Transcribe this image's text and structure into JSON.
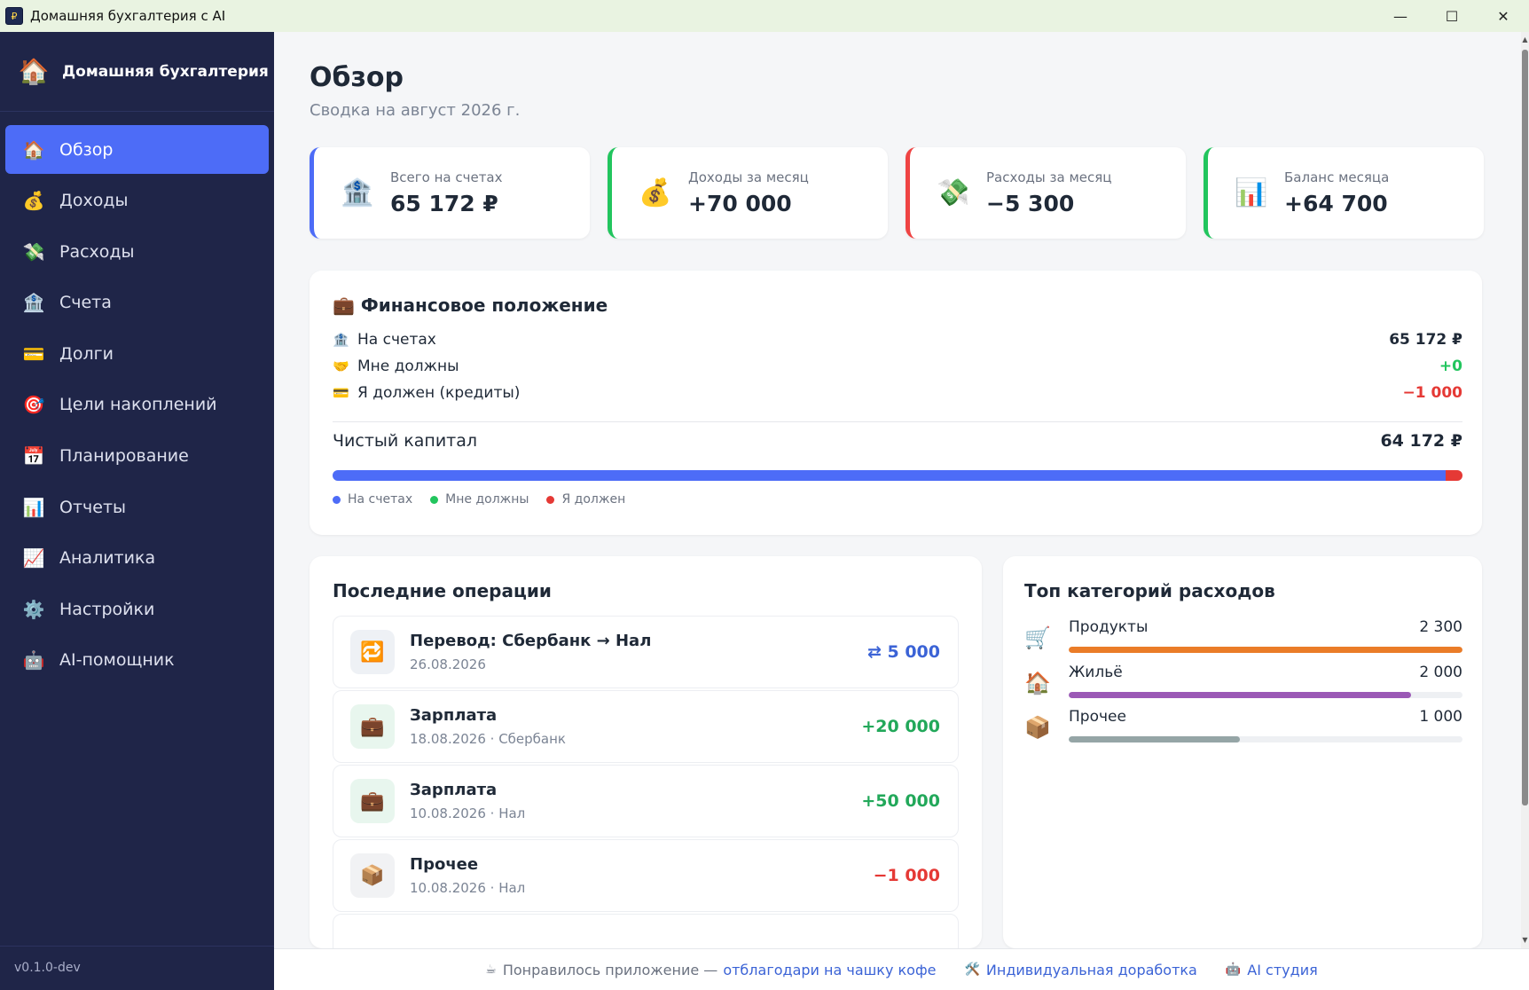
{
  "window": {
    "title": "Домашняя бухгалтерия с AI",
    "icon": "app-icon"
  },
  "sidebar": {
    "brand": {
      "icon": "house-icon",
      "name": "Домашняя бухгалтерия"
    },
    "items": [
      {
        "icon": "house-icon",
        "label": "Обзор",
        "active": true
      },
      {
        "icon": "money-bag-icon",
        "label": "Доходы"
      },
      {
        "icon": "money-wings-icon",
        "label": "Расходы"
      },
      {
        "icon": "bank-icon",
        "label": "Счета"
      },
      {
        "icon": "credit-card-icon",
        "label": "Долги"
      },
      {
        "icon": "target-icon",
        "label": "Цели накоплений"
      },
      {
        "icon": "calendar-icon",
        "label": "Планирование"
      },
      {
        "icon": "bar-chart-icon",
        "label": "Отчеты"
      },
      {
        "icon": "line-chart-icon",
        "label": "Аналитика"
      },
      {
        "icon": "gear-icon",
        "label": "Настройки"
      },
      {
        "icon": "robot-icon",
        "label": "AI-помощник"
      }
    ],
    "version": "v0.1.0-dev"
  },
  "header": {
    "title": "Обзор",
    "subtitle": "Сводка на август 2026 г."
  },
  "kpis": [
    {
      "icon": "bank-icon",
      "label": "Всего на счетах",
      "value": "65 172 ₽",
      "accent": "#4d6cf7"
    },
    {
      "icon": "money-bag-icon",
      "label": "Доходы за месяц",
      "value": "+70 000",
      "accent": "#22c55e"
    },
    {
      "icon": "money-wings-icon",
      "label": "Расходы за месяц",
      "value": "−5 300",
      "accent": "#ef4444"
    },
    {
      "icon": "bar-chart-icon",
      "label": "Баланс месяца",
      "value": "+64 700",
      "accent": "#22c55e"
    }
  ],
  "financial": {
    "title": "Финансовое положение",
    "icon": "briefcase-icon",
    "rows": [
      {
        "icon": "bank-icon",
        "label": "На счетах",
        "value": "65 172 ₽",
        "color": "#1f2937"
      },
      {
        "icon": "handshake-icon",
        "label": "Мне должны",
        "value": "+0",
        "color": "#22c55e"
      },
      {
        "icon": "credit-card-icon",
        "label": "Я должен (кредиты)",
        "value": "−1 000",
        "color": "#e53935"
      }
    ],
    "net": {
      "label": "Чистый капитал",
      "value": "64 172 ₽"
    },
    "bar": {
      "accounts": 65172,
      "owed_to_me": 0,
      "i_owe": 1000
    },
    "legend": [
      {
        "label": "На счетах",
        "color": "#4d6cf7"
      },
      {
        "label": "Мне должны",
        "color": "#22c55e"
      },
      {
        "label": "Я должен",
        "color": "#e53935"
      }
    ]
  },
  "operations": {
    "title": "Последние операции",
    "items": [
      {
        "icon": "transfer-icon",
        "title": "Перевод: Сбербанк → Нал",
        "date": "26.08.2026",
        "amount": "⇄ 5 000",
        "color": "#3b63d6",
        "bg": "#eef1f5"
      },
      {
        "icon": "briefcase-icon",
        "title": "Зарплата",
        "date": "18.08.2026 · Сбербанк",
        "amount": "+20 000",
        "color": "#22a85a",
        "bg": "#e8f6ee"
      },
      {
        "icon": "briefcase-icon",
        "title": "Зарплата",
        "date": "10.08.2026 · Нал",
        "amount": "+50 000",
        "color": "#22a85a",
        "bg": "#e8f6ee"
      },
      {
        "icon": "package-icon",
        "title": "Прочее",
        "date": "10.08.2026 · Нал",
        "amount": "−1 000",
        "color": "#e53935",
        "bg": "#f1f2f4"
      }
    ]
  },
  "top_categories": {
    "title": "Топ категорий расходов",
    "items": [
      {
        "icon": "cart-icon",
        "label": "Продукты",
        "value": "2 300",
        "fraction": 1.0,
        "color": "#ea7c28"
      },
      {
        "icon": "house-icon",
        "label": "Жильё",
        "value": "2 000",
        "fraction": 0.87,
        "color": "#9b59b6"
      },
      {
        "icon": "package-icon",
        "label": "Прочее",
        "value": "1 000",
        "fraction": 0.435,
        "color": "#95a5a6"
      }
    ]
  },
  "footer": {
    "coffee_pre": "Понравилось приложение —",
    "coffee_link": "отблагодари на чашку кофе",
    "custom_link": "Индивидуальная доработка",
    "ai_link": "AI студия"
  }
}
